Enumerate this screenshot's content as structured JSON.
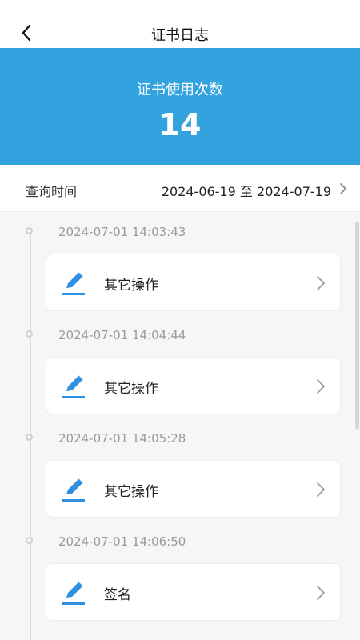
{
  "header": {
    "title": "证书日志"
  },
  "summary": {
    "label": "证书使用次数",
    "count": "14"
  },
  "query": {
    "label": "查询时间",
    "start": "2024-06-19",
    "separator": "至",
    "end": "2024-07-19"
  },
  "logs": [
    {
      "time": "2024-07-01 14:03:43",
      "operation": "其它操作"
    },
    {
      "time": "2024-07-01 14:04:44",
      "operation": "其它操作"
    },
    {
      "time": "2024-07-01 14:05:28",
      "operation": "其它操作"
    },
    {
      "time": "2024-07-01 14:06:50",
      "operation": "签名"
    }
  ],
  "colors": {
    "accent": "#33a3e0",
    "icon": "#2f8fe0"
  }
}
